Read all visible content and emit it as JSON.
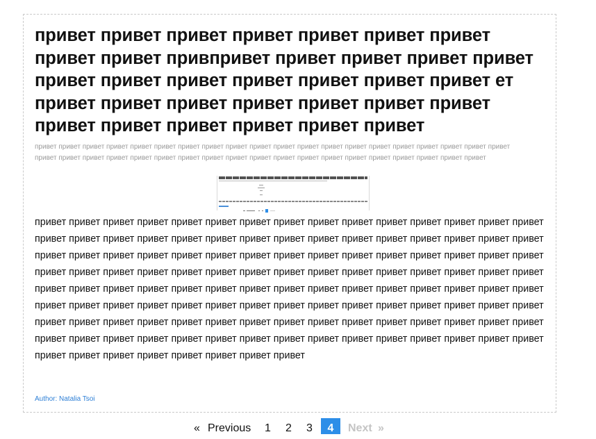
{
  "post": {
    "title": "привет привет привет привет привет привет привет привет привет привпривет привет привет привет привет привет привет привет привет привет привет привет ет привет привет привет привет привет привет привет привет привет привет привет привет привет",
    "excerpt": "привет привет привет привет привет привет привет привет привет привет привет пpивет привет привет привет привет привет привет привет привет привет привет привет привет привет привет привет привет привет привет привет привет привет привет привет привет привет привет привет",
    "body": "привет привет привет привет привет привет привет привет привет привет привет привет привет привет привет привет привет привет привет привет привет привет привет привет привет привет привет привет привет привет привет привет привет привет привет привет привет привет привет привет привет привет привет привет привет привет привет привет привет привет привет привет привет привет привет привет привет привет привет привет привет привет привет привет привет привет привет привет привет привет привет привет привет привет привет привет привет привет привет привет привет привет привет привет привет привет привет привет привет привет привет привет привет привет привет привет привет привет привет привет привет привет привет привет привет привет привет привет привет привет привет привет привет привет привет привет привет привет привет привет привет привет привет привет привет привет привет привет",
    "author": "Author: Natalia Tsoi",
    "thumbnail_title": "приветприветприветприветприветприветприветприветприветприветприветпривет"
  },
  "pagination": {
    "prev_arrow": "«",
    "prev_label": "Previous",
    "pages": [
      "1",
      "2",
      "3",
      "4"
    ],
    "current_page": "4",
    "next_label": "Next",
    "next_arrow": "»"
  },
  "colors": {
    "accent": "#2d8ee8",
    "author_link": "#2d7fd6",
    "excerpt_text": "#9a9a9a",
    "disabled": "#c4c4c4"
  }
}
